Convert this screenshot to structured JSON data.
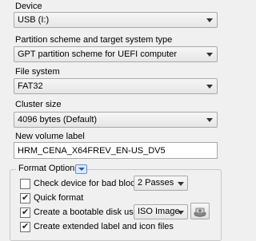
{
  "device": {
    "label": "Device",
    "value": "USB (I:)"
  },
  "partition": {
    "label": "Partition scheme and target system type",
    "value": "GPT partition scheme for UEFI computer"
  },
  "filesystem": {
    "label": "File system",
    "value": "FAT32"
  },
  "cluster": {
    "label": "Cluster size",
    "value": "4096 bytes (Default)"
  },
  "volume": {
    "label": "New volume label",
    "value": "HRM_CENA_X64FREV_EN-US_DV5"
  },
  "format_options": {
    "title": "Format Options",
    "bad_blocks": {
      "label": "Check device for bad blocks:",
      "checked": false,
      "passes": "2 Passes"
    },
    "quick_format": {
      "label": "Quick format",
      "checked": true
    },
    "bootable": {
      "label": "Create a bootable disk using:",
      "checked": true,
      "source": "ISO Image"
    },
    "extended_label": {
      "label": "Create extended label and icon files",
      "checked": true
    }
  }
}
